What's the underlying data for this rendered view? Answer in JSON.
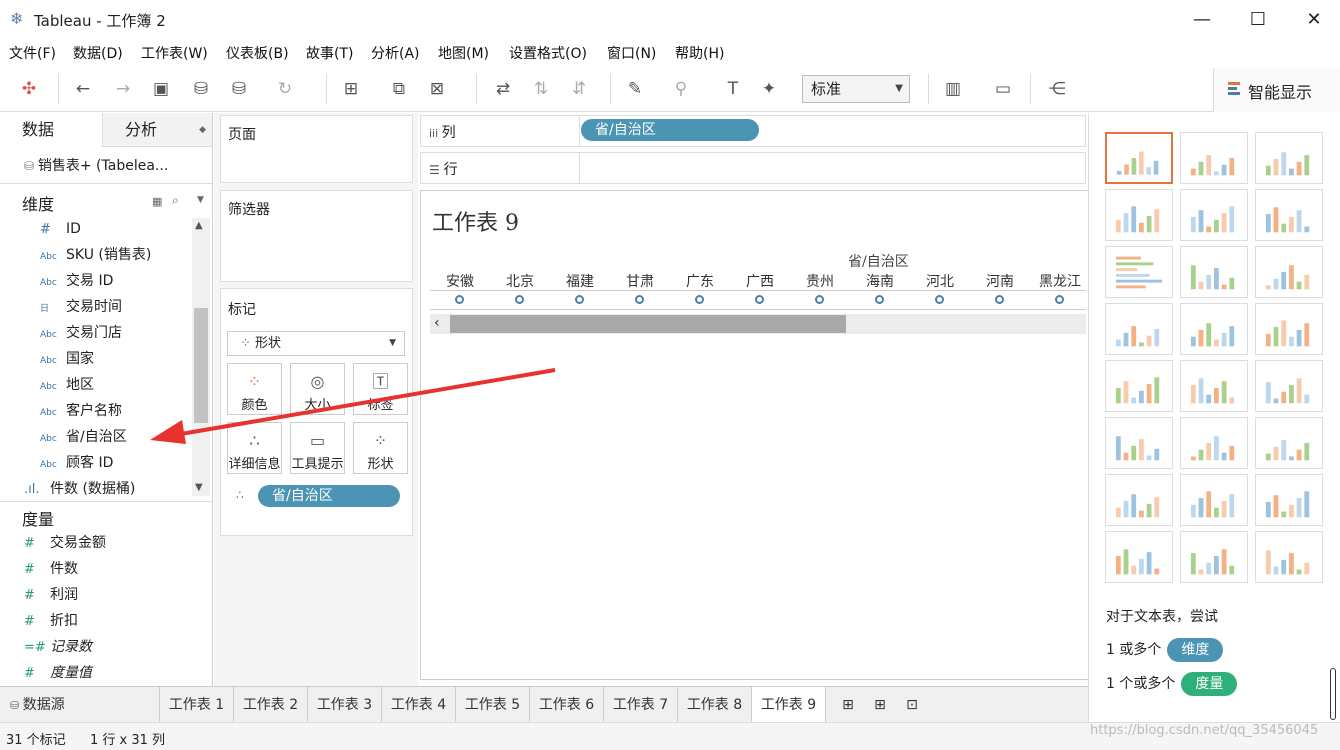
{
  "window": {
    "title": "Tableau - 工作簿 2"
  },
  "menu": [
    "文件(F)",
    "数据(D)",
    "工作表(W)",
    "仪表板(B)",
    "故事(T)",
    "分析(A)",
    "地图(M)",
    "设置格式(O)",
    "窗口(N)",
    "帮助(H)"
  ],
  "toolbar": {
    "fit_select": "标准",
    "show_me_label": "智能显示"
  },
  "left_pane": {
    "tabs": [
      "数据",
      "分析"
    ],
    "datasource": "销售表+ (Tabelea...",
    "dimensions_header": "维度",
    "dimensions": [
      {
        "icon": "#",
        "label": "ID"
      },
      {
        "icon": "Abc",
        "label": "SKU (销售表)"
      },
      {
        "icon": "Abc",
        "label": "交易 ID"
      },
      {
        "icon": "日",
        "label": "交易时间"
      },
      {
        "icon": "Abc",
        "label": "交易门店"
      },
      {
        "icon": "Abc",
        "label": "国家"
      },
      {
        "icon": "Abc",
        "label": "地区"
      },
      {
        "icon": "Abc",
        "label": "客户名称"
      },
      {
        "icon": "Abc",
        "label": "省/自治区"
      },
      {
        "icon": "Abc",
        "label": "顾客 ID"
      }
    ],
    "bin_field": "件数 (数据桶)",
    "measures_header": "度量",
    "measures": [
      {
        "icon": "#",
        "label": "交易金额"
      },
      {
        "icon": "#",
        "label": "件数"
      },
      {
        "icon": "#",
        "label": "利润"
      },
      {
        "icon": "#",
        "label": "折扣"
      },
      {
        "icon": "=#",
        "label": "记录数"
      },
      {
        "icon": "#",
        "label": "度量值"
      }
    ]
  },
  "cards": {
    "pages": "页面",
    "filters": "筛选器",
    "marks": "标记",
    "mark_type": "形状",
    "mark_buttons": [
      "颜色",
      "大小",
      "标签",
      "详细信息",
      "工具提示",
      "形状"
    ],
    "detail_pill": "省/自治区"
  },
  "shelves": {
    "columns_label": "列",
    "rows_label": "行",
    "columns_pill": "省/自治区"
  },
  "view": {
    "sheet_title": "工作表 9",
    "axis_header": "省/自治区",
    "provinces": [
      "安徽",
      "北京",
      "福建",
      "甘肃",
      "广东",
      "广西",
      "贵州",
      "海南",
      "河北",
      "河南",
      "黑龙江"
    ]
  },
  "show_me": {
    "hint": "对于文本表，尝试",
    "dim_prefix": "1 或多个",
    "dim_pill": "维度",
    "meas_prefix": "1 个或多个",
    "meas_pill": "度量",
    "dim_color": "#4b94b4",
    "meas_color": "#2fb07a"
  },
  "sheet_tabs": {
    "datasource": "数据源",
    "tabs": [
      "工作表 1",
      "工作表 2",
      "工作表 3",
      "工作表 4",
      "工作表 5",
      "工作表 6",
      "工作表 7",
      "工作表 8",
      "工作表 9"
    ],
    "active": "工作表 9"
  },
  "status": {
    "marks": "31 个标记",
    "dims": "1 行 x 31 列"
  },
  "watermark": "https://blog.csdn.net/qq_35456045"
}
